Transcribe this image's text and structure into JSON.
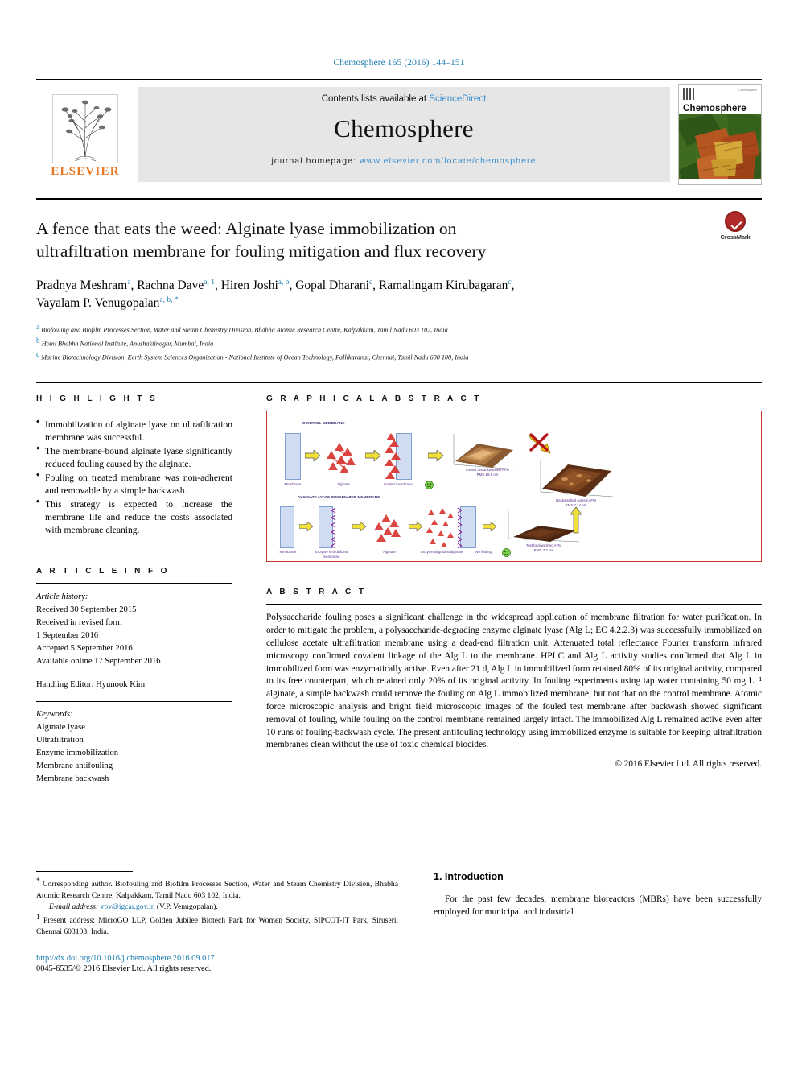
{
  "running_head": "Chemosphere 165 (2016) 144–151",
  "masthead": {
    "publisher": "ELSEVIER",
    "contents_prefix": "Contents lists available at ",
    "contents_link": "ScienceDirect",
    "journal_name": "Chemosphere",
    "homepage_prefix": "journal homepage: ",
    "homepage_url": "www.elsevier.com/locate/chemosphere",
    "cover_brand": "Chemosphere",
    "cover_tiny": "Chemosphere"
  },
  "article": {
    "title": "A fence that eats the weed: Alginate lyase immobilization on ultrafiltration membrane for fouling mitigation and flux recovery",
    "crossmark_label": "CrossMark",
    "authors": [
      {
        "name": "Pradnya Meshram",
        "sup": "a",
        "sep": ", "
      },
      {
        "name": "Rachna Dave",
        "sup": "a, 1",
        "sep": ", "
      },
      {
        "name": "Hiren Joshi",
        "sup": "a, b",
        "sep": ", "
      },
      {
        "name": "Gopal Dharani",
        "sup": "c",
        "sep": ", "
      },
      {
        "name": "Ramalingam Kirubagaran",
        "sup": "c",
        "sep": ", "
      },
      {
        "name": "Vayalam P. Venugopalan",
        "sup": "a, b, *",
        "sep": ""
      }
    ],
    "affiliations": [
      {
        "mark": "a",
        "text": "Biofouling and Biofilm Processes Section, Water and Steam Chemistry Division, Bhabha Atomic Research Centre, Kalpakkam, Tamil Nadu 603 102, India"
      },
      {
        "mark": "b",
        "text": "Homi Bhabha National Institute, Anushaktinagar, Mumbai, India"
      },
      {
        "mark": "c",
        "text": "Marine Biotechnology Division, Earth System Sciences Organization - National Institute of Ocean Technology, Pallikaranai, Chennai, Tamil Nadu 600 100, India"
      }
    ]
  },
  "highlights": {
    "heading": "H I G H L I G H T S",
    "items": [
      "Immobilization of alginate lyase on ultrafiltration membrane was successful.",
      "The membrane-bound alginate lyase significantly reduced fouling caused by the alginate.",
      "Fouling on treated membrane was non-adherent and removable by a simple backwash.",
      "This strategy is expected to increase the membrane life and reduce the costs associated with membrane cleaning."
    ]
  },
  "article_info": {
    "heading": "A R T I C L E   I N F O",
    "history_label": "Article history:",
    "history": [
      "Received 30 September 2015",
      "Received in revised form",
      "1 September 2016",
      "Accepted 5 September 2016",
      "Available online 17 September 2016"
    ],
    "handling_editor": "Handling Editor: Hyunook Kim",
    "keywords_label": "Keywords:",
    "keywords": [
      "Alginate lyase",
      "Ultrafiltration",
      "Enzyme immobilization",
      "Membrane antifouling",
      "Membrane backwash"
    ]
  },
  "graphical_abstract": {
    "heading": "G R A P H I C A L   A B S T R A C T",
    "row1_title": "CONTROL MEMBRANE",
    "row2_title": "ALGINATE LYASE IMMOBILIZED MEMBRANE",
    "labels": {
      "membrane": "Membrane",
      "alginate": "Alginate",
      "fouled_membrane": "Fouled membrane",
      "enzyme_membrane": "Enzyme immobilized membrane",
      "degraded": "Enzyme degraded alginate",
      "no_fouling": "No fouling",
      "afm_fouled": "Fouled unbackwashed AFM",
      "afm_fouled_rms": "RMS 18.6 nm",
      "afm_control": "Backwashed control AFM",
      "afm_control_rms": "RMS 7.14 nm",
      "afm_test": "Test backwashed AFM",
      "afm_test_rms": "RMS 7.2 nm"
    }
  },
  "abstract": {
    "heading": "A B S T R A C T",
    "text": "Polysaccharide fouling poses a significant challenge in the widespread application of membrane filtration for water purification. In order to mitigate the problem, a polysaccharide-degrading enzyme alginate lyase (Alg L; EC 4.2.2.3) was successfully immobilized on cellulose acetate ultrafiltration membrane using a dead-end filtration unit. Attenuated total reflectance Fourier transform infrared microscopy confirmed covalent linkage of the Alg L to the membrane. HPLC and Alg L activity studies confirmed that Alg L in immobilized form was enzymatically active. Even after 21 d, Alg L in immobilized form retained 80% of its original activity, compared to its free counterpart, which retained only 20% of its original activity. In fouling experiments using tap water containing 50 mg L⁻¹ alginate, a simple backwash could remove the fouling on Alg L immobilized membrane, but not that on the control membrane. Atomic force microscopic analysis and bright field microscopic images of the fouled test membrane after backwash showed significant removal of fouling, while fouling on the control membrane remained largely intact. The immobilized Alg L remained active even after 10 runs of fouling-backwash cycle. The present antifouling technology using immobilized enzyme is suitable for keeping ultrafiltration membranes clean without the use of toxic chemical biocides.",
    "copyright": "© 2016 Elsevier Ltd. All rights reserved."
  },
  "footer": {
    "corresponding_mark": "*",
    "corresponding": "Corresponding author. Biofouling and Biofilm Processes Section, Water and Steam Chemistry Division, Bhabha Atomic Research Centre, Kalpakkam, Tamil Nadu 603 102, India.",
    "email_label": "E-mail address:",
    "email": "vpv@igcar.gov.in",
    "email_owner": "(V.P. Venugopalan).",
    "present_mark": "1",
    "present_address": "Present address: MicroGO LLP, Golden Jubilee Biotech Park for Women Society, SIPCOT-IT Park, Siruseri, Chennai 603103, India.",
    "doi": "http://dx.doi.org/10.1016/j.chemosphere.2016.09.017",
    "issn": "0045-6535/© 2016 Elsevier Ltd. All rights reserved."
  },
  "introduction": {
    "heading": "1.  Introduction",
    "text": "For the past few decades, membrane bioreactors (MBRs) have been successfully employed for municipal and industrial"
  }
}
